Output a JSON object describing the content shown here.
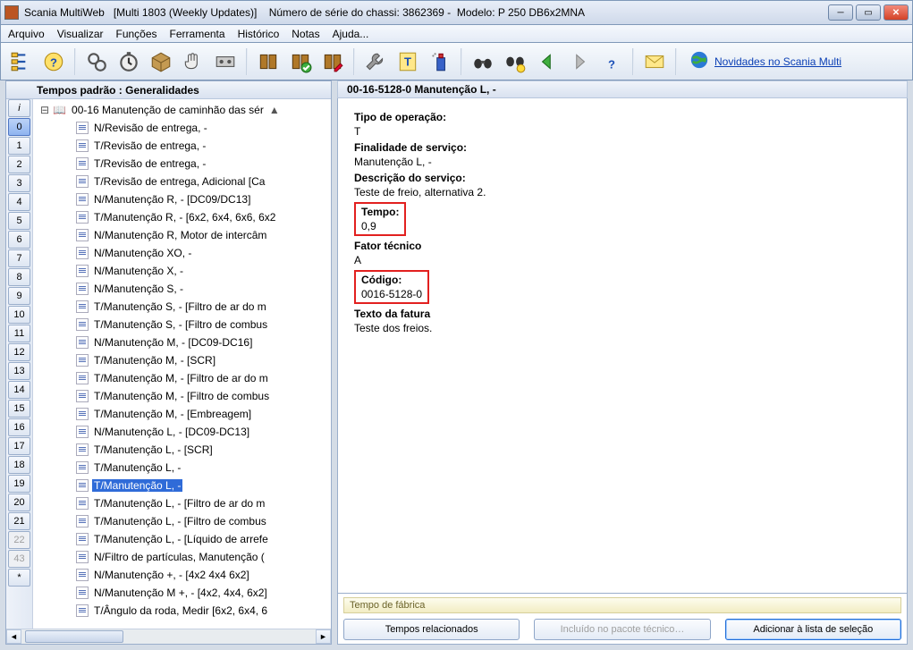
{
  "window": {
    "app": "Scania MultiWeb",
    "build": "[Multi 1803 (Weekly Updates)]",
    "chassis_label": "Número de série do chassi:",
    "chassis": "3862369",
    "model_label": "Modelo:",
    "model": "P 250 DB6x2MNA"
  },
  "menu": [
    "Arquivo",
    "Visualizar",
    "Funções",
    "Ferramenta",
    "Histórico",
    "Notas",
    "Ajuda..."
  ],
  "news_link": "Novidades no Scania Multi",
  "left_header": "Tempos padrão : Generalidades",
  "numbers": [
    "i",
    "0",
    "1",
    "2",
    "3",
    "4",
    "5",
    "6",
    "7",
    "8",
    "9",
    "10",
    "11",
    "12",
    "13",
    "14",
    "15",
    "16",
    "17",
    "18",
    "19",
    "20",
    "21",
    "22",
    "43",
    "*"
  ],
  "num_selected": "0",
  "num_disabled": [
    "22",
    "43"
  ],
  "tree_root": "00-16 Manutenção de caminhão das sér",
  "tree_items": [
    "N/Revisão de entrega, -",
    "T/Revisão de entrega, -",
    "T/Revisão de entrega, -",
    "T/Revisão de entrega, Adicional [Ca",
    "N/Manutenção R, - [DC09/DC13]",
    "T/Manutenção R, - [6x2, 6x4, 6x6, 6x2",
    "N/Manutenção R, Motor de intercâm",
    "N/Manutenção XO, -",
    "N/Manutenção X, -",
    "N/Manutenção S, -",
    "T/Manutenção S, - [Filtro de ar do m",
    "T/Manutenção S, - [Filtro de combus",
    "N/Manutenção M, - [DC09-DC16]",
    "T/Manutenção M, - [SCR]",
    "T/Manutenção M, - [Filtro de ar do m",
    "T/Manutenção M, - [Filtro de combus",
    "T/Manutenção M, - [Embreagem]",
    "N/Manutenção L, - [DC09-DC13]",
    "T/Manutenção L, - [SCR]",
    "T/Manutenção L, -",
    "T/Manutenção L, -",
    "T/Manutenção L, - [Filtro de ar do m",
    "T/Manutenção L, - [Filtro de combus",
    "T/Manutenção L, - [Líquido de arrefe",
    "N/Filtro de partículas, Manutenção (",
    "N/Manutenção +, - [4x2 4x4 6x2]",
    "N/Manutenção M +, - [4x2, 4x4, 6x2]",
    "T/Ângulo da roda, Medir [6x2, 6x4, 6"
  ],
  "tree_selected_index": 20,
  "right_header": "00-16-5128-0 Manutenção L, -",
  "details": {
    "op_type_lbl": "Tipo de operação:",
    "op_type": "T",
    "finality_lbl": "Finalidade de serviço:",
    "finality": "Manutenção L, -",
    "desc_lbl": "Descrição do serviço:",
    "desc": "Teste de freio, alternativa 2.",
    "time_lbl": "Tempo:",
    "time": "0,9",
    "factor_lbl": "Fator técnico",
    "factor": "A",
    "code_lbl": "Código:",
    "code": "0016-5128-0",
    "invoice_lbl": "Texto da fatura",
    "invoice": "Teste dos freios."
  },
  "factory_label": "Tempo de fábrica",
  "buttons": {
    "related": "Tempos relacionados",
    "included": "Incluído no pacote técnico…",
    "add": "Adicionar à lista de seleção"
  }
}
